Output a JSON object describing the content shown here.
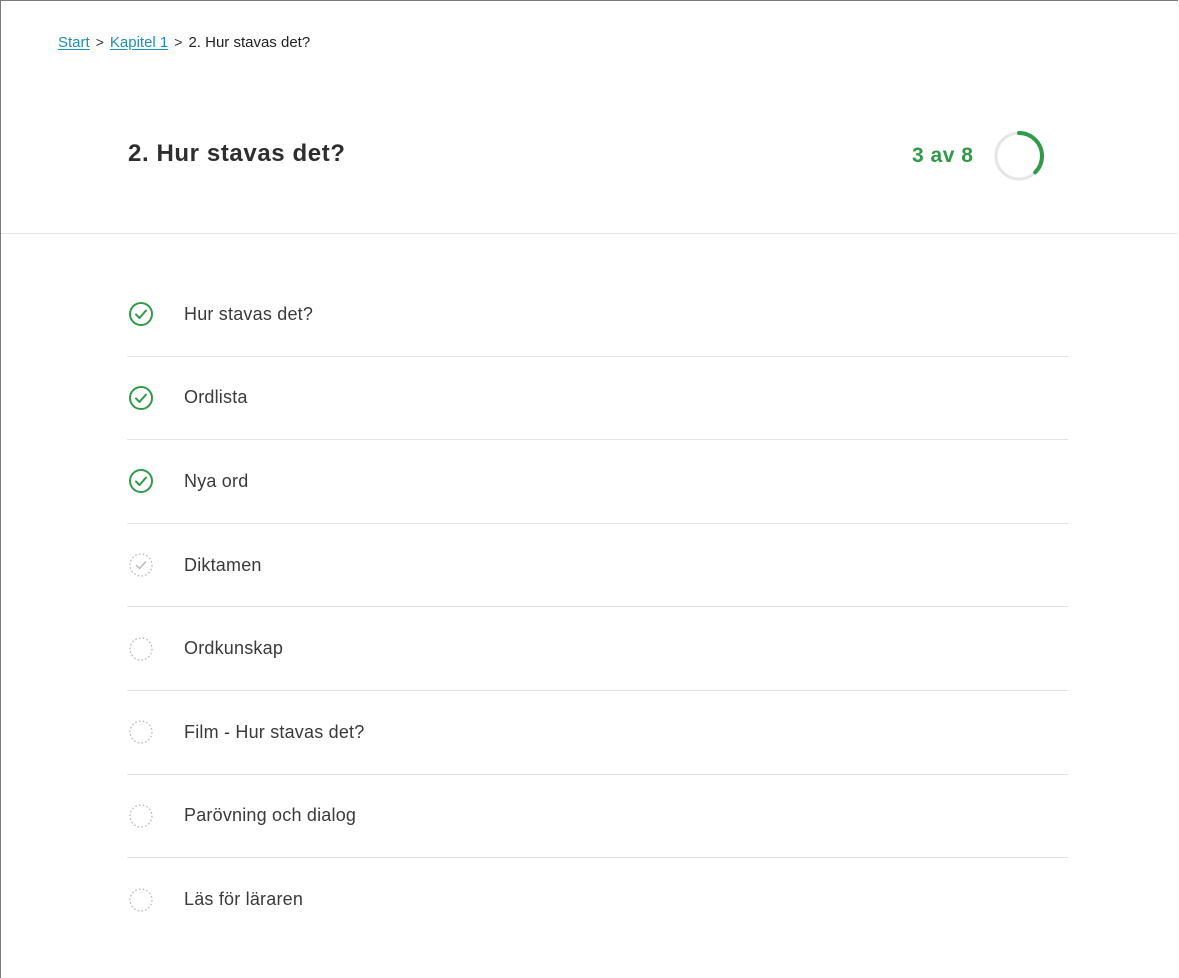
{
  "breadcrumb": {
    "items": [
      {
        "label": "Start",
        "link": true
      },
      {
        "label": "Kapitel 1",
        "link": true
      },
      {
        "label": "2. Hur stavas det?",
        "link": false
      }
    ],
    "separator": ">"
  },
  "page": {
    "title": "2. Hur stavas det?"
  },
  "progress": {
    "text": "3 av 8",
    "completed": 3,
    "total": 8,
    "color": "#2f9a48",
    "track_color": "#e6e6e6"
  },
  "steps": [
    {
      "label": "Hur stavas det?",
      "status": "done"
    },
    {
      "label": "Ordlista",
      "status": "done"
    },
    {
      "label": "Nya ord",
      "status": "done"
    },
    {
      "label": "Diktamen",
      "status": "partial"
    },
    {
      "label": "Ordkunskap",
      "status": "todo"
    },
    {
      "label": "Film - Hur stavas det?",
      "status": "todo"
    },
    {
      "label": "Parövning och dialog",
      "status": "todo"
    },
    {
      "label": "Läs för läraren",
      "status": "todo"
    }
  ],
  "icons": {
    "done": "check-circle-icon",
    "partial": "dotted-check-circle-icon",
    "todo": "dotted-circle-icon"
  },
  "colors": {
    "link": "#1f8fb8",
    "done": "#2f9a48",
    "pending": "#b8b8b8"
  }
}
